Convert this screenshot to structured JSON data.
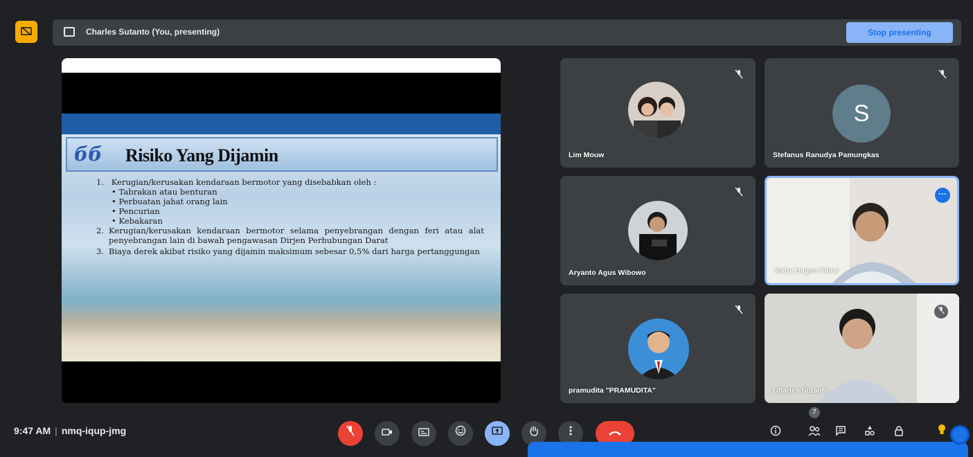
{
  "topbar": {
    "presenter_label": "Charles Sutanto (You, presenting)",
    "stop_label": "Stop presenting"
  },
  "slide": {
    "badge": "бб",
    "title": "Risiko Yang Dijamin",
    "items": [
      {
        "num": "1.",
        "text": "Kerugian/kerusakan kendaraan bermotor yang disebabkan oleh :",
        "subs": [
          "• Tabrakan atau benturan",
          "• Perbuatan jahat orang lain",
          "• Pencurian",
          "• Kebakaran"
        ]
      },
      {
        "num": "2.",
        "text": "Kerugian/kerusakan kendaraan bermotor selama penyebrangan dengan feri atau alat penyebrangan lain di bawah pengawasan Dirjen Perhubungan Darat"
      },
      {
        "num": "3.",
        "text": "Biaya derek akibat risiko yang dijamin maksimum sebesar 0,5% dari harga pertanggungan"
      }
    ]
  },
  "participants": [
    {
      "name": "Lim Mouw"
    },
    {
      "name": "Stefanus Ranudya Pamungkas",
      "initial": "S"
    },
    {
      "name": "Aryanto Agus Wibowo"
    },
    {
      "name": "Ratty Bagus Kilaw"
    },
    {
      "name": "pramudita \"PRAMUDITA\""
    },
    {
      "name": "Charles Sutanto"
    }
  ],
  "bottom": {
    "time": "9:47 AM",
    "meeting_code": "nmq-iqup-jmg",
    "people_count": "7"
  },
  "colors": {
    "background": "#202124",
    "tile": "#3c4043",
    "accent": "#8ab4f8",
    "danger": "#ea4335"
  }
}
